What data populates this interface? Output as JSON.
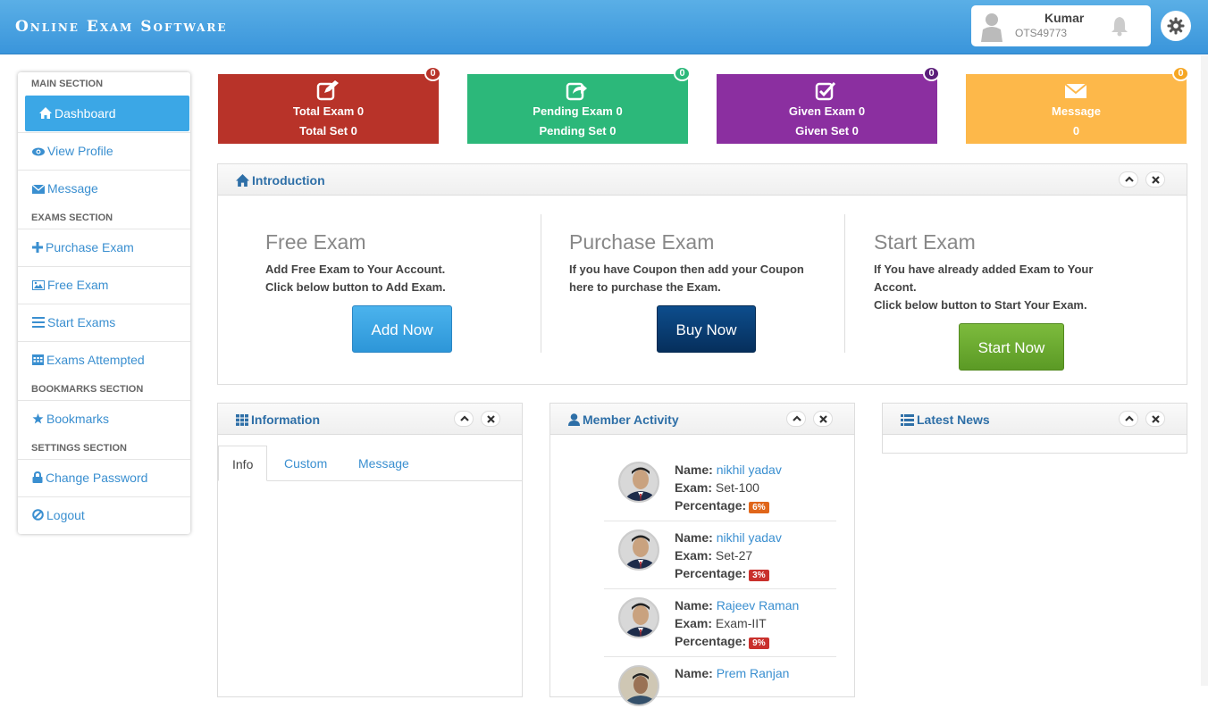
{
  "header": {
    "brand": "Online Exam Software",
    "user_name": "Kumar",
    "user_id": "OTS49773"
  },
  "sidebar": {
    "sections": [
      "MAIN SECTION",
      "EXAMS SECTION",
      "BOOKMARKS SECTION",
      "SETTINGS SECTION"
    ],
    "items": [
      {
        "label": "Dashboard",
        "icon": "home-icon"
      },
      {
        "label": "View Profile",
        "icon": "eye-icon"
      },
      {
        "label": "Message",
        "icon": "envelope-icon"
      },
      {
        "label": "Purchase Exam",
        "icon": "plus-icon"
      },
      {
        "label": "Free Exam",
        "icon": "picture-icon"
      },
      {
        "label": "Start Exams",
        "icon": "list-icon"
      },
      {
        "label": "Exams Attempted",
        "icon": "calendar-icon"
      },
      {
        "label": "Bookmarks",
        "icon": "star-icon"
      },
      {
        "label": "Change Password",
        "icon": "lock-icon"
      },
      {
        "label": "Logout",
        "icon": "ban-icon"
      }
    ]
  },
  "tiles": [
    {
      "line1": "Total Exam 0",
      "line2": "Total Set 0",
      "badge": "0",
      "color": "#b83329",
      "badge_color": "#b83329"
    },
    {
      "line1": "Pending Exam 0",
      "line2": "Pending Set 0",
      "badge": "0",
      "color": "#2cb87a",
      "badge_color": "#2cb87a"
    },
    {
      "line1": "Given Exam 0",
      "line2": "Given Set 0",
      "badge": "0",
      "color": "#8b2fa0",
      "badge_color": "#5b1e7a"
    },
    {
      "line1": "Message",
      "line2": "0",
      "badge": "0",
      "color": "#fdb84a",
      "badge_color": "#f5a623"
    }
  ],
  "introduction": {
    "title": "Introduction",
    "columns": [
      {
        "heading": "Free Exam",
        "text1": "Add Free Exam to Your Account.",
        "text2": "Click below button to Add Exam.",
        "text3": "",
        "button": "Add Now"
      },
      {
        "heading": "Purchase Exam",
        "text1": "If you have Coupon then add your Coupon",
        "text2": "here to purchase the Exam.",
        "text3": "",
        "button": "Buy Now"
      },
      {
        "heading": "Start Exam",
        "text1": "If You have already added Exam to Your",
        "text2": "Accont.",
        "text3": "Click below button to Start Your Exam.",
        "button": "Start Now"
      }
    ]
  },
  "information": {
    "title": "Information",
    "tabs": [
      "Info",
      "Custom",
      "Message"
    ]
  },
  "member_activity": {
    "title": "Member Activity",
    "labels": {
      "name": "Name:",
      "exam": "Exam:",
      "percentage": "Percentage:"
    },
    "members": [
      {
        "name": "nikhil yadav",
        "exam": "Set-100",
        "percentage": "6%",
        "pct_color": "#e0661a"
      },
      {
        "name": "nikhil yadav",
        "exam": "Set-27",
        "percentage": "3%",
        "pct_color": "#c9302c"
      },
      {
        "name": "Rajeev Raman",
        "exam": "Exam-IIT",
        "percentage": "9%",
        "pct_color": "#c9302c"
      },
      {
        "name": "Prem Ranjan",
        "exam": "",
        "percentage": "",
        "pct_color": "#c9302c"
      }
    ]
  },
  "latest_news": {
    "title": "Latest News"
  }
}
